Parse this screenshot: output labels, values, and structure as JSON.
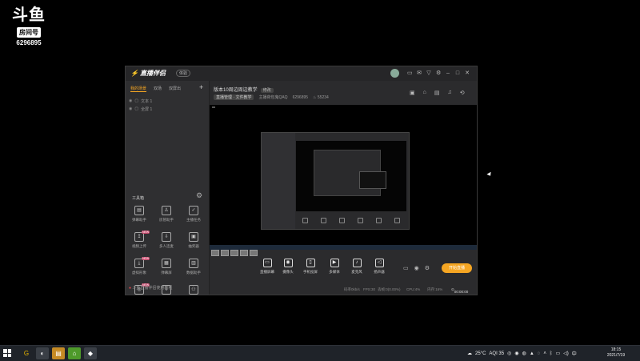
{
  "watermark": {
    "brand": "斗鱼",
    "tag": "房间号",
    "room_id": "6296895"
  },
  "app": {
    "name": "直播伴侣",
    "edition": "体验",
    "titlebar_icons": [
      "chat-icon",
      "mail-icon",
      "shirt-icon",
      "settings-icon",
      "minimize-icon",
      "maximize-icon",
      "close-icon"
    ]
  },
  "sidebar": {
    "scene_tabs": [
      "我的场景",
      "双场",
      "双屏出"
    ],
    "sources": [
      "文本 1",
      "全屏 1"
    ],
    "tools_title": "工具箱",
    "tools": [
      {
        "label": "弹幕助手",
        "icon": "▤",
        "badge": ""
      },
      {
        "label": "房管助手",
        "icon": "♙",
        "badge": ""
      },
      {
        "label": "主播任务",
        "icon": "✓",
        "badge": ""
      },
      {
        "label": "视频上传",
        "icon": "↥",
        "badge": "NEW"
      },
      {
        "label": "多人连麦",
        "icon": "⇩",
        "badge": ""
      },
      {
        "label": "抽奖器",
        "icon": "▣",
        "badge": ""
      },
      {
        "label": "虚拟形象",
        "icon": "⤓",
        "badge": "NEW"
      },
      {
        "label": "弹幕屏",
        "icon": "▦",
        "badge": ""
      },
      {
        "label": "数据助手",
        "icon": "▥",
        "badge": ""
      },
      {
        "label": "",
        "icon": "◎",
        "badge": "NEW"
      },
      {
        "label": "",
        "icon": "⇩",
        "badge": ""
      },
      {
        "label": "",
        "icon": "⚇",
        "badge": ""
      }
    ],
    "footer": "斗鱼直播伴侣使用教程"
  },
  "room": {
    "title": "版本10周边周边教学",
    "edit_label": "修改",
    "category": "直播管理 · 文件教学",
    "owner": "主播荷包鬼QAQ",
    "room_id": "6296895",
    "heat": "55234"
  },
  "controls": [
    {
      "label": "直播屏幕",
      "icon": "▭"
    },
    {
      "label": "摄像头",
      "icon": "◉"
    },
    {
      "label": "手机投屏",
      "icon": "▯"
    },
    {
      "label": "多媒体",
      "icon": "▶"
    },
    {
      "label": "麦克风",
      "icon": "♪"
    },
    {
      "label": "扬声器",
      "icon": "◁"
    }
  ],
  "start_label": "开始直播",
  "status": {
    "stats": [
      "码率0kb/s",
      "FPS:30",
      "丢帧:0(0.00%)",
      "CPU:4%",
      "内存:16%"
    ],
    "timer": "00:00:00"
  },
  "taskbar": {
    "weather": "25°C",
    "aqi": "AQI 35",
    "ime": "中",
    "time": "18:15",
    "date": "2021/7/19"
  }
}
